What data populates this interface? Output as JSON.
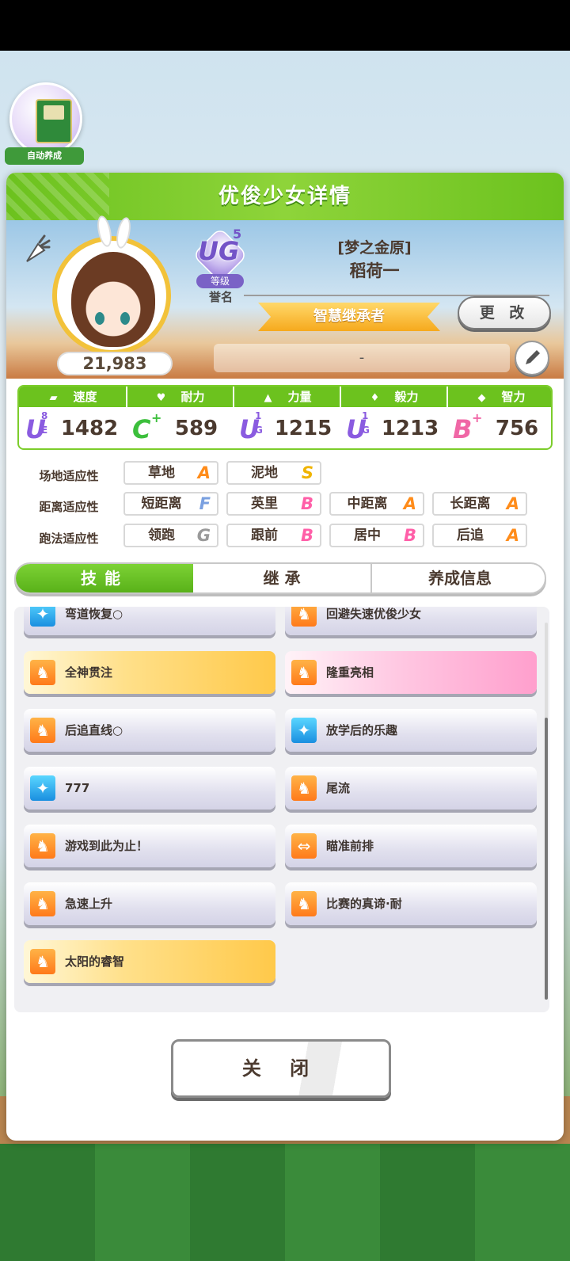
{
  "auto_training": {
    "label": "自动养成"
  },
  "header": {
    "title": "优俊少女详情"
  },
  "profile": {
    "fans": "21,983",
    "rank": {
      "letters": "UG",
      "num": "5",
      "tag": "等级",
      "sub": "誉名"
    },
    "character_title": "[梦之金原]",
    "character_name": "稻荷一",
    "banner": "智慧继承者",
    "change_button": "更 改",
    "memo_text": "-"
  },
  "stats": [
    {
      "label": "速度",
      "icon": "shoe-icon",
      "grade": "U",
      "grade_sub": "E",
      "grade_num": "8",
      "value": "1482",
      "color": "#8a5be0"
    },
    {
      "label": "耐力",
      "icon": "heart-icon",
      "grade": "C",
      "grade_sub": "+",
      "grade_num": "",
      "value": "589",
      "color": "#3cbf3c"
    },
    {
      "label": "力量",
      "icon": "arm-icon",
      "grade": "U",
      "grade_sub": "G",
      "grade_num": "1",
      "value": "1215",
      "color": "#8a5be0"
    },
    {
      "label": "毅力",
      "icon": "flame-icon",
      "grade": "U",
      "grade_sub": "G",
      "grade_num": "1",
      "value": "1213",
      "color": "#8a5be0"
    },
    {
      "label": "智力",
      "icon": "graduation-cap-icon",
      "grade": "B",
      "grade_sub": "+",
      "grade_num": "",
      "value": "756",
      "color": "#f067a6"
    }
  ],
  "aptitude": {
    "field": {
      "label": "场地适应性",
      "items": [
        {
          "name": "草地",
          "grade": "A"
        },
        {
          "name": "泥地",
          "grade": "S"
        }
      ]
    },
    "distance": {
      "label": "距离适应性",
      "items": [
        {
          "name": "短距离",
          "grade": "F"
        },
        {
          "name": "英里",
          "grade": "B"
        },
        {
          "name": "中距离",
          "grade": "A"
        },
        {
          "name": "长距离",
          "grade": "A"
        }
      ]
    },
    "style": {
      "label": "跑法适应性",
      "items": [
        {
          "name": "领跑",
          "grade": "G"
        },
        {
          "name": "跟前",
          "grade": "B"
        },
        {
          "name": "居中",
          "grade": "B"
        },
        {
          "name": "后追",
          "grade": "A"
        }
      ]
    }
  },
  "grade_colors": {
    "S": "#f0b400",
    "A": "#ff8c1a",
    "B": "#ff5fa8",
    "F": "#7aa0e0",
    "G": "#9a9a9a"
  },
  "tabs": [
    {
      "label": "技能",
      "active": true
    },
    {
      "label": "继 承",
      "active": false
    },
    {
      "label": "养成信息",
      "active": false
    }
  ],
  "skills": [
    {
      "name": "弯道恢复○",
      "type": "normal",
      "icon": "blue"
    },
    {
      "name": "回避失速优俊少女",
      "type": "normal",
      "icon": "orange"
    },
    {
      "name": "全神贯注",
      "type": "gold",
      "icon": "orange"
    },
    {
      "name": "隆重亮相",
      "type": "pink",
      "icon": "orange"
    },
    {
      "name": "后追直线○",
      "type": "normal",
      "icon": "orange"
    },
    {
      "name": "放学后的乐趣",
      "type": "normal",
      "icon": "blue"
    },
    {
      "name": "777",
      "type": "normal",
      "icon": "blue"
    },
    {
      "name": "尾流",
      "type": "normal",
      "icon": "orange"
    },
    {
      "name": "游戏到此为止！",
      "type": "normal",
      "icon": "orange"
    },
    {
      "name": "瞄准前排",
      "type": "normal",
      "icon": "orange"
    },
    {
      "name": "急速上升",
      "type": "normal",
      "icon": "orange"
    },
    {
      "name": "比赛的真谛·耐",
      "type": "normal",
      "icon": "orange"
    },
    {
      "name": "太阳的睿智",
      "type": "gold",
      "icon": "orange"
    }
  ],
  "footer": {
    "close_button": "关 闭"
  }
}
